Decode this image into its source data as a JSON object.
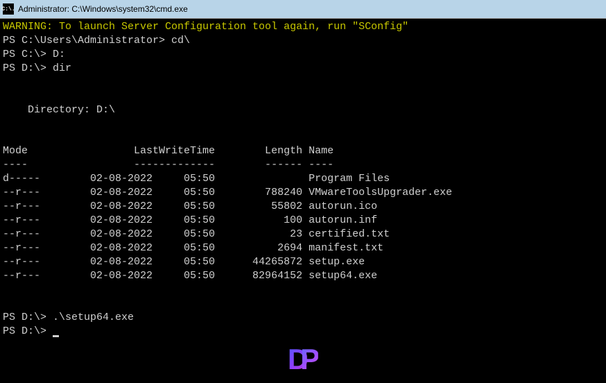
{
  "window": {
    "title": "Administrator: C:\\Windows\\system32\\cmd.exe",
    "icon_label": "C:\\."
  },
  "terminal": {
    "warning": "WARNING: To launch Server Configuration tool again, run \"SConfig\"",
    "lines": [
      {
        "prompt": "PS C:\\Users\\Administrator>",
        "command": "cd\\"
      },
      {
        "prompt": "PS C:\\>",
        "command": "D:"
      },
      {
        "prompt": "PS D:\\>",
        "command": "dir"
      }
    ],
    "directory_label": "    Directory: D:\\",
    "headers": {
      "mode": "Mode",
      "lastwrite": "LastWriteTime",
      "length": "Length",
      "name": "Name"
    },
    "header_dashes": {
      "mode": "----",
      "lastwrite": "-------------",
      "length": "------",
      "name": "----"
    },
    "entries": [
      {
        "mode": "d-----",
        "date": "02-08-2022",
        "time": "05:50",
        "length": "",
        "name": "Program Files"
      },
      {
        "mode": "--r---",
        "date": "02-08-2022",
        "time": "05:50",
        "length": "788240",
        "name": "VMwareToolsUpgrader.exe"
      },
      {
        "mode": "--r---",
        "date": "02-08-2022",
        "time": "05:50",
        "length": "55802",
        "name": "autorun.ico"
      },
      {
        "mode": "--r---",
        "date": "02-08-2022",
        "time": "05:50",
        "length": "100",
        "name": "autorun.inf"
      },
      {
        "mode": "--r---",
        "date": "02-08-2022",
        "time": "05:50",
        "length": "23",
        "name": "certified.txt"
      },
      {
        "mode": "--r---",
        "date": "02-08-2022",
        "time": "05:50",
        "length": "2694",
        "name": "manifest.txt"
      },
      {
        "mode": "--r---",
        "date": "02-08-2022",
        "time": "05:50",
        "length": "44265872",
        "name": "setup.exe"
      },
      {
        "mode": "--r---",
        "date": "02-08-2022",
        "time": "05:50",
        "length": "82964152",
        "name": "setup64.exe"
      }
    ],
    "post_lines": [
      {
        "prompt": "PS D:\\>",
        "command": ".\\setup64.exe"
      },
      {
        "prompt": "PS D:\\>",
        "command": ""
      }
    ]
  },
  "logo": {
    "letter1": "D",
    "letter2": "P"
  }
}
